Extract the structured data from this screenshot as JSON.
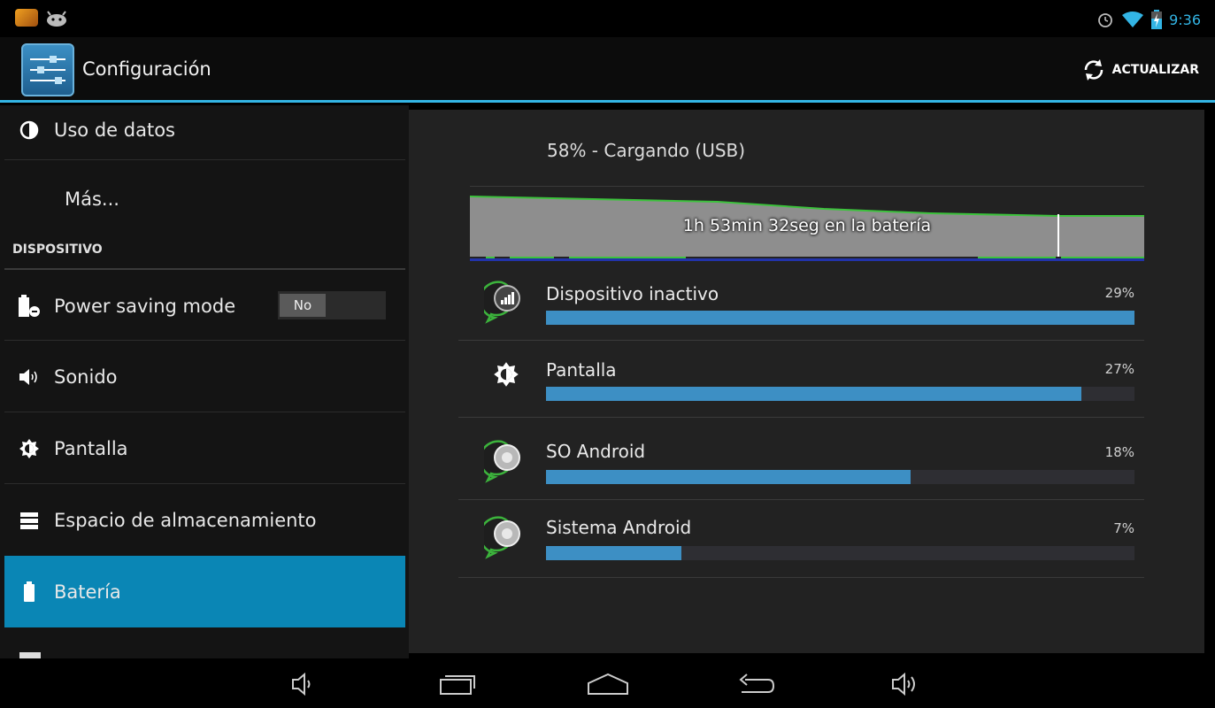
{
  "status_bar": {
    "time": "9:36",
    "icons": [
      "app-notification-icon",
      "android-debug-icon",
      "alarm-icon",
      "wifi-icon",
      "battery-charging-icon"
    ]
  },
  "action_bar": {
    "title": "Configuración",
    "refresh_label": "ACTUALIZAR"
  },
  "sidebar": {
    "items": [
      {
        "label": "Uso de datos",
        "icon": "data-usage-icon"
      },
      {
        "label": "Más..."
      },
      {
        "label": "Power saving mode",
        "icon": "power-saving-icon",
        "toggle": "No"
      },
      {
        "label": "Sonido",
        "icon": "sound-icon"
      },
      {
        "label": "Pantalla",
        "icon": "display-icon"
      },
      {
        "label": "Espacio de almacenamiento",
        "icon": "storage-icon"
      },
      {
        "label": "Batería",
        "icon": "battery-icon",
        "selected": true
      }
    ],
    "section_header": "DISPOSITIVO"
  },
  "battery": {
    "status": "58% - Cargando (USB)",
    "graph_label": "1h 53min 32seg en la batería",
    "usage": [
      {
        "name": "Dispositivo inactivo",
        "percent_label": "29%",
        "bar_fraction": 1.0,
        "icon": "cell-standby-icon"
      },
      {
        "name": "Pantalla",
        "percent_label": "27%",
        "bar_fraction": 0.91,
        "icon": "display-icon"
      },
      {
        "name": "SO Android",
        "percent_label": "18%",
        "bar_fraction": 0.62,
        "icon": "android-os-icon"
      },
      {
        "name": "Sistema Android",
        "percent_label": "7%",
        "bar_fraction": 0.23,
        "icon": "android-system-icon"
      }
    ]
  },
  "colors": {
    "accent": "#33b5e5",
    "selected": "#0a86b5",
    "bar": "#3d8fc4",
    "graph_line": "#3cc23c"
  },
  "nav_bar": {
    "buttons": [
      "volume-down-icon",
      "recent-apps-icon",
      "home-icon",
      "back-icon",
      "volume-up-icon"
    ]
  }
}
